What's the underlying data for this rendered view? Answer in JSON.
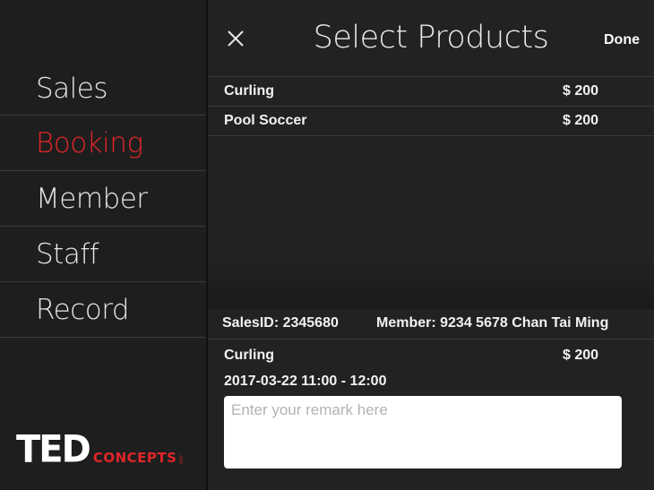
{
  "sidebar": {
    "items": [
      {
        "label": "Sales",
        "active": false
      },
      {
        "label": "Booking",
        "active": true
      },
      {
        "label": "Member",
        "active": false
      },
      {
        "label": "Staff",
        "active": false
      },
      {
        "label": "Record",
        "active": false
      }
    ],
    "logo": {
      "main": "TED",
      "sub": "CONCEPTS",
      "suffix": ".com"
    }
  },
  "header": {
    "title": "Select Products",
    "done_label": "Done",
    "close_icon": "close-icon"
  },
  "products": [
    {
      "name": "Curling",
      "price": "$ 200"
    },
    {
      "name": "Pool Soccer",
      "price": "$ 200"
    }
  ],
  "sales": {
    "sales_id": "SalesID: 2345680",
    "member": "Member: 9234 5678 Chan Tai Ming"
  },
  "selected": {
    "name": "Curling",
    "price": "$ 200",
    "time": "2017-03-22 11:00 - 12:00"
  },
  "remark": {
    "value": "",
    "placeholder": "Enter your remark here"
  },
  "colors": {
    "accent": "#e0262a",
    "background": "#222222"
  }
}
